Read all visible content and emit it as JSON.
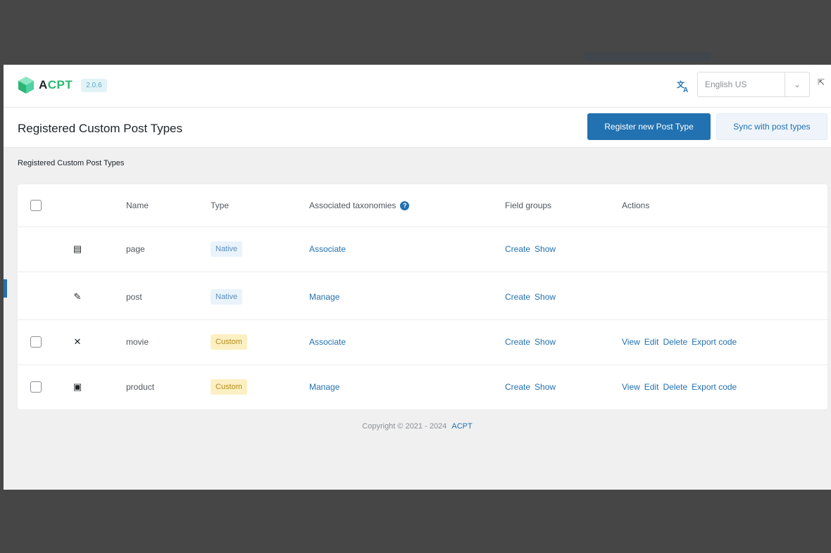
{
  "app": {
    "logo_prefix": "A",
    "logo_accent": "CPT",
    "version": "2.0.6",
    "language": "English US"
  },
  "header": {
    "title": "Registered Custom Post Types",
    "register_button": "Register new Post Type",
    "sync_button": "Sync with post types"
  },
  "section_label": "Registered Custom Post Types",
  "table": {
    "columns": {
      "name": "Name",
      "type": "Type",
      "taxonomies": "Associated taxonomies",
      "field_groups": "Field groups",
      "actions": "Actions"
    },
    "rows": [
      {
        "icon": "page-icon",
        "glyph": "▤",
        "name": "page",
        "type": "Native",
        "type_kind": "native",
        "taxonomy_action": "Associate",
        "fg_create": "Create",
        "fg_show": "Show",
        "has_checkbox": false,
        "actions": []
      },
      {
        "icon": "pin-icon",
        "glyph": "✎",
        "name": "post",
        "type": "Native",
        "type_kind": "native",
        "taxonomy_action": "Manage",
        "fg_create": "Create",
        "fg_show": "Show",
        "has_checkbox": false,
        "actions": []
      },
      {
        "icon": "movie-icon",
        "glyph": "✕",
        "name": "movie",
        "type": "Custom",
        "type_kind": "custom",
        "taxonomy_action": "Associate",
        "fg_create": "Create",
        "fg_show": "Show",
        "has_checkbox": true,
        "actions": [
          "View",
          "Edit",
          "Delete",
          "Export code"
        ]
      },
      {
        "icon": "product-icon",
        "glyph": "▣",
        "name": "product",
        "type": "Custom",
        "type_kind": "custom",
        "taxonomy_action": "Manage",
        "fg_create": "Create",
        "fg_show": "Show",
        "has_checkbox": true,
        "actions": [
          "View",
          "Edit",
          "Delete",
          "Export code"
        ]
      }
    ]
  },
  "footer": {
    "copyright": "Copyright © 2021 - 2024",
    "brand": "ACPT"
  },
  "colors": {
    "accent": "#2271b1",
    "logo_green": "#2bb673",
    "custom_badge": "#fcf0c3",
    "native_badge": "#eaf3fb"
  }
}
